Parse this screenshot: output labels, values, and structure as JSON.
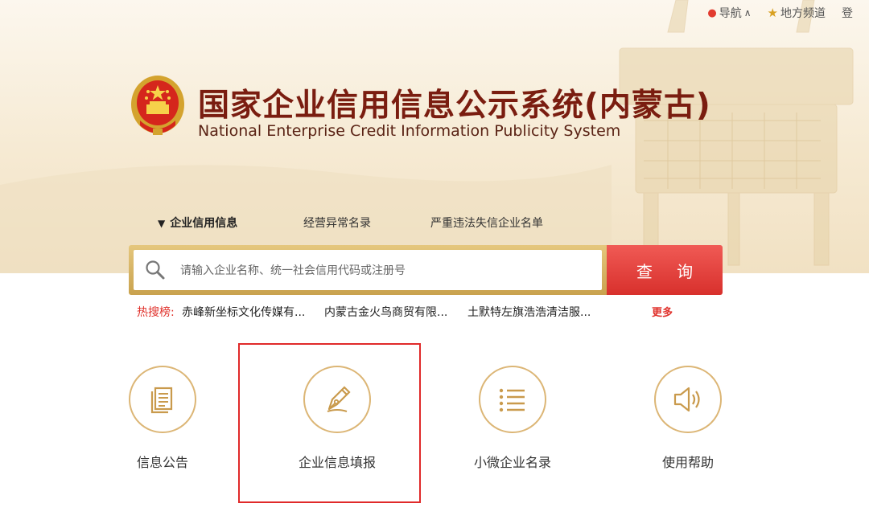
{
  "top_nav": {
    "nav_label": "导航",
    "local_channel_label": "地方频道",
    "login_label_partial": "登"
  },
  "header": {
    "title_cn": "国家企业信用信息公示系统(内蒙古)",
    "title_en": "National Enterprise Credit Information Publicity System"
  },
  "search_tabs": [
    {
      "label": "企业信用信息",
      "active": true
    },
    {
      "label": "经营异常名录",
      "active": false
    },
    {
      "label": "严重违法失信企业名单",
      "active": false
    }
  ],
  "search": {
    "placeholder": "请输入企业名称、统一社会信用代码或注册号",
    "button_label": "查 询"
  },
  "hot_search": {
    "label": "热搜榜:",
    "items": [
      "赤峰新坐标文化传媒有...",
      "内蒙古金火鸟商贸有限...",
      "土默特左旗浩浩清洁服..."
    ],
    "more_label": "更多"
  },
  "features": [
    {
      "label": "信息公告",
      "icon": "document-icon"
    },
    {
      "label": "企业信息填报",
      "icon": "pen-nib-icon",
      "highlighted": true
    },
    {
      "label": "小微企业名录",
      "icon": "list-icon"
    },
    {
      "label": "使用帮助",
      "icon": "speaker-icon"
    }
  ],
  "colors": {
    "accent_red": "#e0302a",
    "gold_border": "#dcb676",
    "title_brown": "#7a1d10",
    "search_button": "#e03a35"
  }
}
